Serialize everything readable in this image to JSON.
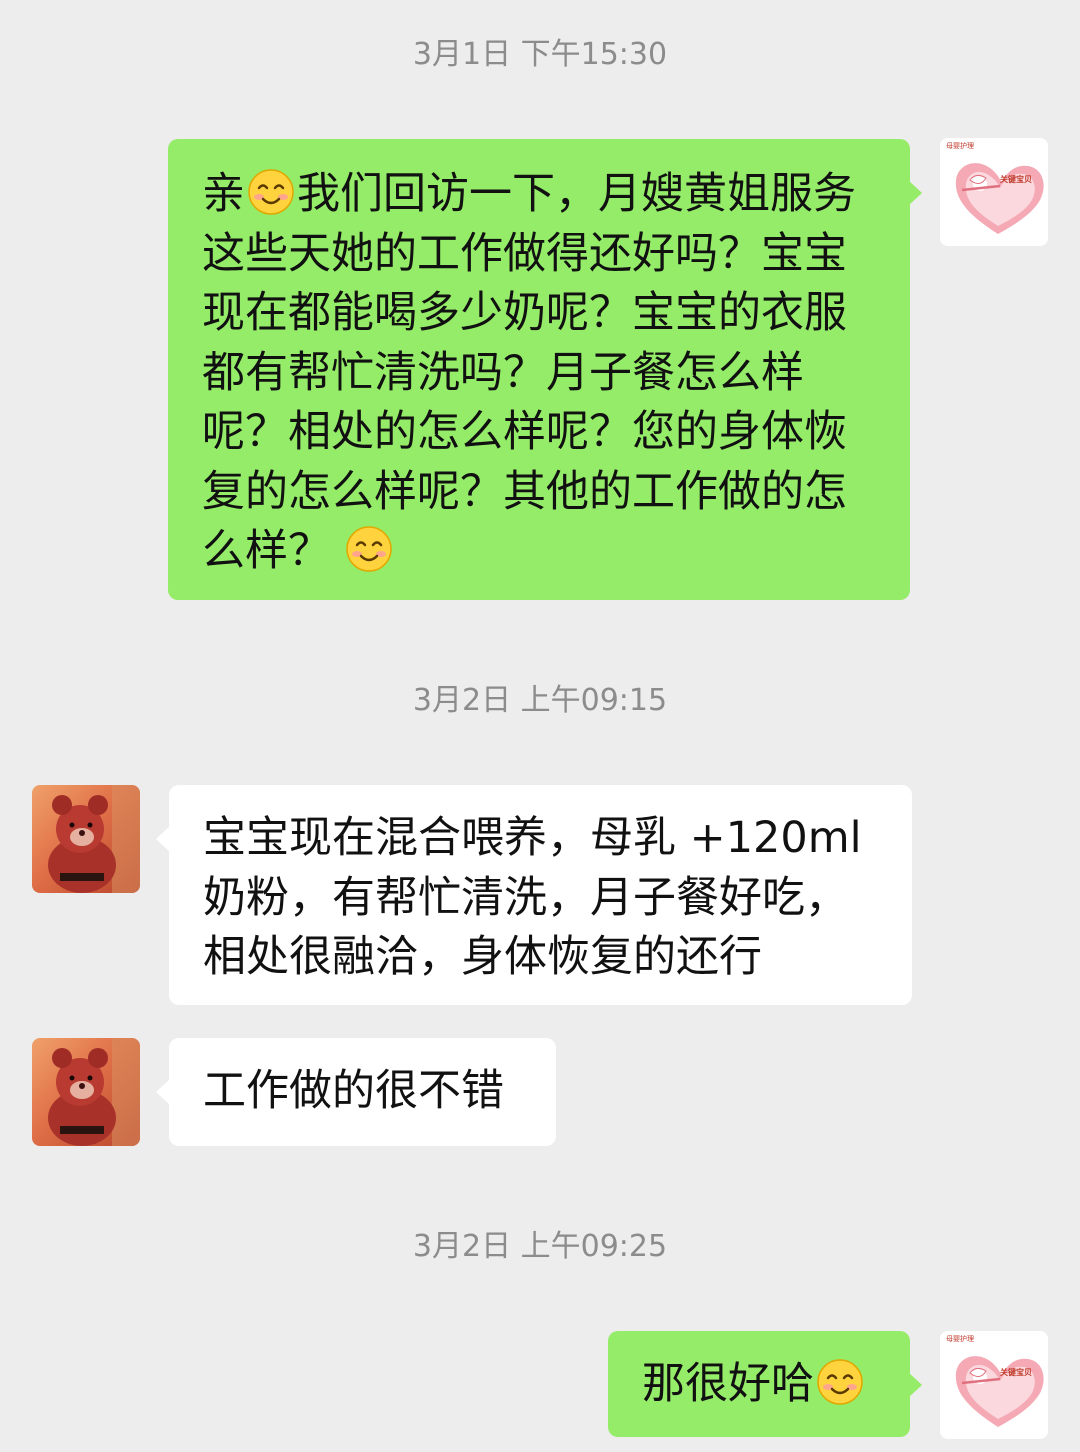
{
  "chat": {
    "timestamp_1": "3月1日 下午15:30",
    "timestamp_2": "3月2日 上午09:15",
    "timestamp_3": "3月2日 上午09:25",
    "msg_1": {
      "part_1": "亲",
      "part_2": "我们回访一下，月嫂黄姐服务这些天她的工作做得还好吗？宝宝现在都能喝多少奶呢？宝宝的衣服都有帮忙清洗吗？月子餐怎么样呢？相处的怎么样呢？您的身体恢复的怎么样呢？其他的工作做的怎么样？"
    },
    "msg_2": "宝宝现在混合喂养，母乳 +120ml奶粉，有帮忙清洗，月子餐好吃，相处很融洽，身体恢复的还行",
    "msg_3": "工作做的很不错",
    "msg_4": {
      "text": "那很好哈"
    },
    "self_avatar": {
      "label": "母婴护理",
      "brand": "关键宝贝",
      "icon": "heart-cupid-logo"
    },
    "other_avatar": {
      "icon": "teddy-bear-photo"
    },
    "emoji_name": "smile-emoji",
    "colors": {
      "background": "#ededed",
      "self_bubble": "#95ec69",
      "other_bubble": "#ffffff",
      "timestamp": "#8c8c8c"
    }
  }
}
